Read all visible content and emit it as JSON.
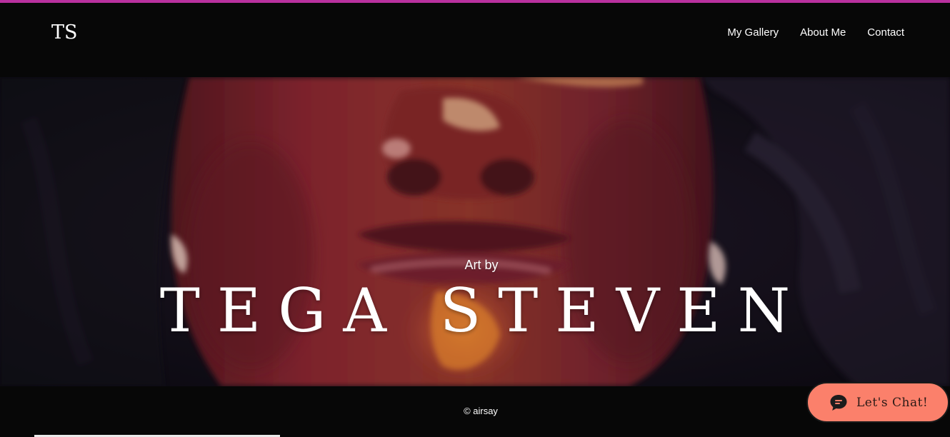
{
  "header": {
    "logo": "TS",
    "nav": [
      {
        "label": "My Gallery"
      },
      {
        "label": "About Me"
      },
      {
        "label": "Contact"
      }
    ]
  },
  "hero": {
    "kicker": "Art by",
    "title": "TEGA STEVEN",
    "image_subject": "oil painting close-up of a face"
  },
  "footer": {
    "copyright": "© airsay"
  },
  "chat": {
    "label": "Let's Chat!",
    "icon": "chat-bubble-icon",
    "color": "#fb806b"
  },
  "colors": {
    "accent_strip": "#b8309e",
    "background": "#070707",
    "text": "#ffffff"
  }
}
